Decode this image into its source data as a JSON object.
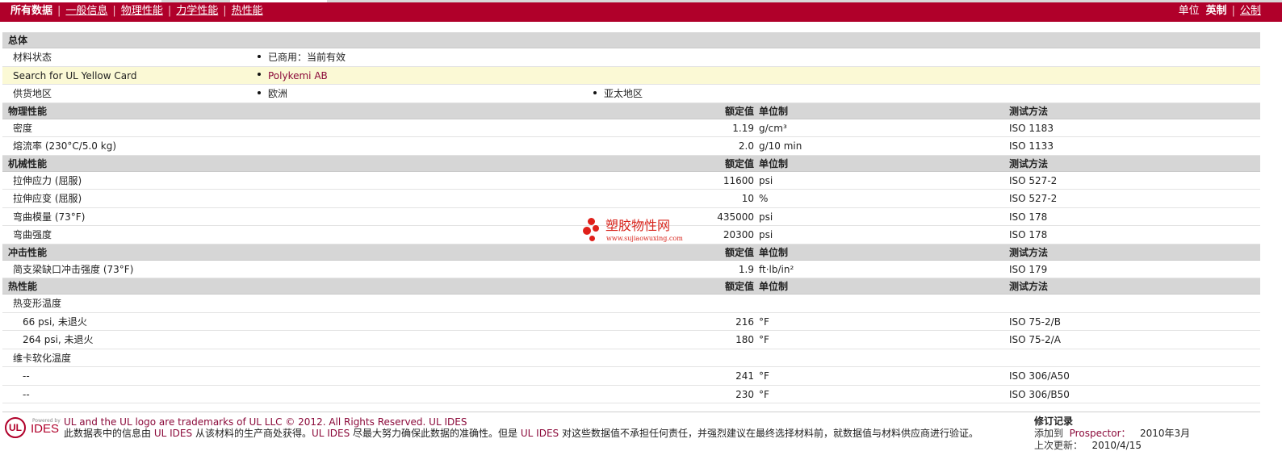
{
  "nav": {
    "current": "所有数据",
    "items": [
      "一般信息",
      "物理性能",
      "力学性能",
      "热性能"
    ]
  },
  "units": {
    "label": "单位",
    "current": "英制",
    "other": "公制"
  },
  "general": {
    "section": "总体",
    "rows": [
      {
        "name": "材料状态",
        "b1": "已商用：当前有效",
        "b2": ""
      },
      {
        "name": "Search for UL Yellow Card",
        "b1": "Polykemi AB",
        "b2": ""
      },
      {
        "name": "供货地区",
        "b1": "欧洲",
        "b2": "亚太地区"
      }
    ]
  },
  "columns": {
    "value": "额定值",
    "unit": "单位制",
    "test": "测试方法"
  },
  "physical": {
    "section": "物理性能",
    "rows": [
      {
        "name": "密度",
        "cond": "",
        "value": "1.19",
        "unit": "g/cm³",
        "test": "ISO 1183"
      },
      {
        "name": "熔流率",
        "cond": "(230°C/5.0 kg)",
        "value": "2.0",
        "unit": "g/10 min",
        "test": "ISO 1133"
      }
    ]
  },
  "mechanical": {
    "section": "机械性能",
    "rows": [
      {
        "name": "拉伸应力",
        "cond": "(屈服)",
        "value": "11600",
        "unit": "psi",
        "test": "ISO 527-2"
      },
      {
        "name": "拉伸应变",
        "cond": "(屈服)",
        "value": "10",
        "unit": "%",
        "test": "ISO 527-2"
      },
      {
        "name": "弯曲模量",
        "cond": "(73°F)",
        "value": "435000",
        "unit": "psi",
        "test": "ISO 178"
      },
      {
        "name": "弯曲强度",
        "cond": "",
        "value": "20300",
        "unit": "psi",
        "test": "ISO 178"
      }
    ]
  },
  "impact": {
    "section": "冲击性能",
    "rows": [
      {
        "name": "简支梁缺口冲击强度",
        "cond": "(73°F)",
        "value": "1.9",
        "unit": "ft·lb/in²",
        "test": "ISO 179"
      }
    ]
  },
  "thermal": {
    "section": "热性能",
    "hdt": {
      "name": "热变形温度"
    },
    "hdt_rows": [
      {
        "name": "66 psi, 未退火",
        "value": "216",
        "unit": "°F",
        "test": "ISO 75-2/B"
      },
      {
        "name": "264 psi, 未退火",
        "value": "180",
        "unit": "°F",
        "test": "ISO 75-2/A"
      }
    ],
    "vicat": {
      "name": "维卡软化温度"
    },
    "vicat_rows": [
      {
        "name": "--",
        "value": "241",
        "unit": "°F",
        "test": "ISO 306/A50"
      },
      {
        "name": "--",
        "value": "230",
        "unit": "°F",
        "test": "ISO 306/B50"
      }
    ]
  },
  "watermark": {
    "title": "塑胶物性网",
    "url": "www.sujiaowuxing.com"
  },
  "footer": {
    "logo_small": "Powered by",
    "logo_main": "IDES",
    "logo_ul": "UL",
    "legal1": "UL and the UL logo are trademarks of UL LLC © 2012. All Rights Reserved. UL IDES",
    "legal2_a": "此数据表中的信息由",
    "legal2_link1": "UL IDES",
    "legal2_b": "从该材料的生产商处获得。",
    "legal2_link2": "UL IDES",
    "legal2_c": "尽最大努力确保此数据的准确性。但是",
    "legal2_link3": "UL IDES",
    "legal2_d": "对这些数据值不承担任何责任，并强烈建议在最终选择材料前，就数据值与材料供应商进行验证。",
    "rev_title": "修订记录",
    "rev_added_label": "添加到",
    "rev_added_source": "Prospector：",
    "rev_added_date": "2010年3月",
    "rev_updated_label": "上次更新：",
    "rev_updated_date": "2010/4/15"
  }
}
